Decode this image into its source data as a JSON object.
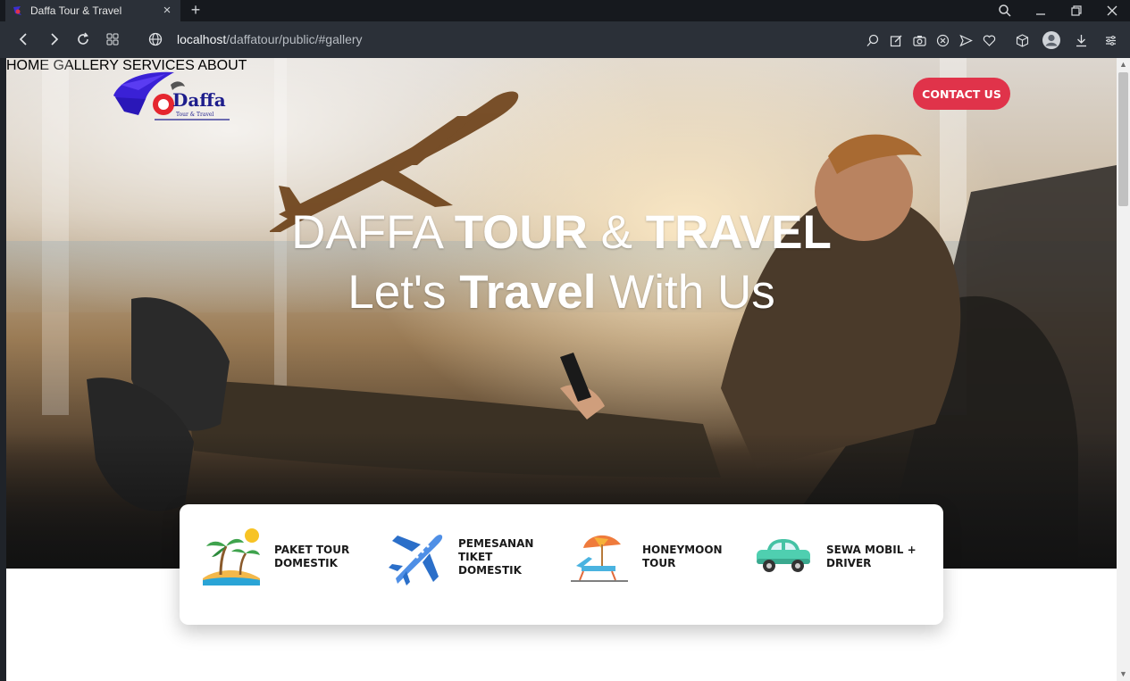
{
  "browser": {
    "tab_title": "Daffa Tour & Travel",
    "url_host": "localhost",
    "url_path": "/daffatour/public/#gallery"
  },
  "brand": {
    "logo_text": "Daffa",
    "logo_subtext": "Tour & Travel"
  },
  "nav": {
    "items": [
      "HOME",
      "GALLERY",
      "SERVICES",
      "ABOUT"
    ],
    "cta": "CONTACT US"
  },
  "hero": {
    "title_light_1": "DAFFA ",
    "title_bold_1": "TOUR",
    "title_light_2": " & ",
    "title_bold_2": "TRAVEL",
    "sub_light_1": "Let's ",
    "sub_bold": "Travel",
    "sub_light_2": " With Us"
  },
  "services": [
    {
      "line1": "PAKET TOUR",
      "line2": "DOMESTIK",
      "icon": "island-icon"
    },
    {
      "line1": "PEMESANAN",
      "line2": "TIKET DOMESTIK",
      "icon": "airplane-icon"
    },
    {
      "line1": "HONEYMOON",
      "line2": "TOUR",
      "icon": "beach-umbrella-icon"
    },
    {
      "line1": "SEWA MOBIL +",
      "line2": "DRIVER",
      "icon": "car-icon"
    }
  ],
  "colors": {
    "accent": "#e0334a",
    "chrome_dark": "#2b3038",
    "tabbar": "#16191e"
  }
}
